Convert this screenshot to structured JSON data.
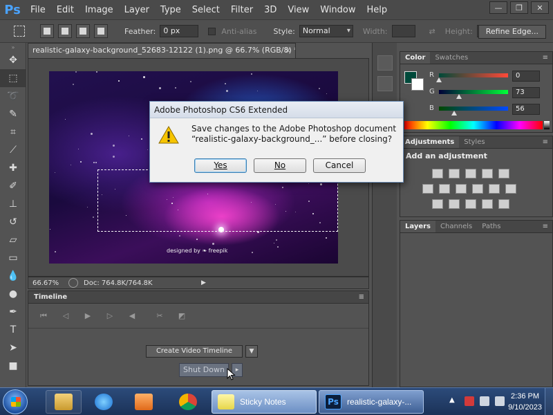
{
  "menubar": {
    "logo": "Ps",
    "items": [
      "File",
      "Edit",
      "Image",
      "Layer",
      "Type",
      "Select",
      "Filter",
      "3D",
      "View",
      "Window",
      "Help"
    ],
    "window_controls": [
      "—",
      "❐",
      "✕"
    ]
  },
  "options_bar": {
    "feather_label": "Feather:",
    "feather_value": "0 px",
    "antialias_label": "Anti-alias",
    "style_label": "Style:",
    "style_value": "Normal",
    "width_label": "Width:",
    "height_label": "Height:",
    "refine_edge": "Refine Edge..."
  },
  "document": {
    "tab_title": "realistic-galaxy-background_52683-12122 (1).png @ 66.7% (RGB/8) *",
    "close": "×",
    "watermark": "designed by ❧ freepik",
    "zoom": "66.67%",
    "doc_size": "Doc: 764.8K/764.8K"
  },
  "timeline": {
    "title": "Timeline",
    "create_button": "Create Video Timeline",
    "shutdown_button": "Shut Down"
  },
  "color_panel": {
    "tabs": [
      "Color",
      "Swatches"
    ],
    "channels": [
      {
        "label": "R",
        "value": "0",
        "fraction": 0.0
      },
      {
        "label": "G",
        "value": "73",
        "fraction": 0.29
      },
      {
        "label": "B",
        "value": "56",
        "fraction": 0.22
      }
    ]
  },
  "adjustments_panel": {
    "tabs": [
      "Adjustments",
      "Styles"
    ],
    "title": "Add an adjustment"
  },
  "layers_panel": {
    "tabs": [
      "Layers",
      "Channels",
      "Paths"
    ]
  },
  "dialog": {
    "title": "Adobe Photoshop CS6 Extended",
    "message_line1": "Save changes to the Adobe Photoshop document",
    "message_line2": "“realistic-galaxy-background_...” before closing?",
    "yes": "Yes",
    "no": "No",
    "cancel": "Cancel"
  },
  "taskbar": {
    "sticky_notes": "Sticky Notes",
    "photoshop": "realistic-galaxy-...",
    "time": "2:36 PM",
    "date": "9/10/2023"
  },
  "colors": {
    "foreground": "#00493a",
    "background": "#ffffff",
    "ps_blue": "#4aa3ff"
  }
}
